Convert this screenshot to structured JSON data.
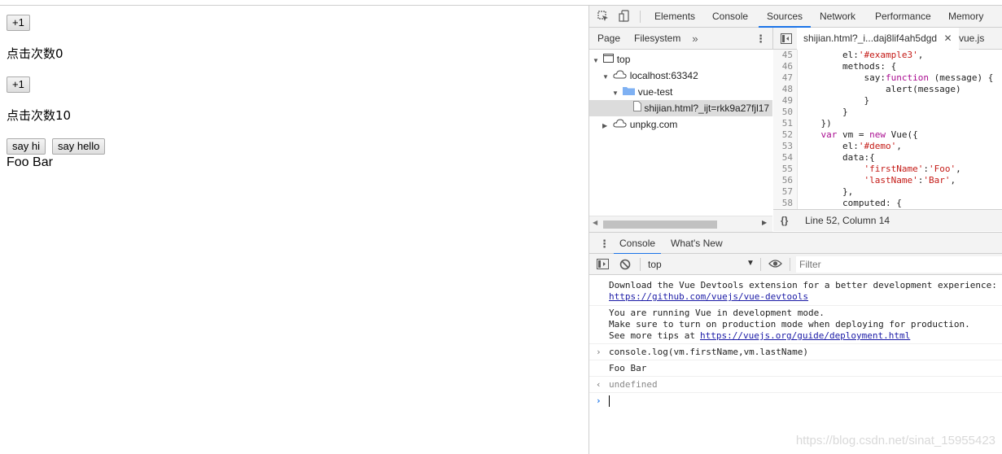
{
  "page": {
    "btn_plus_1": "+1",
    "count_text_1": "点击次数0",
    "btn_plus_2": "+1",
    "count_text_2": "点击次数10",
    "btn_say_hi": "say hi",
    "btn_say_hello": "say hello",
    "full_name": "Foo Bar"
  },
  "devtools": {
    "main_tabs": [
      "Elements",
      "Console",
      "Sources",
      "Network",
      "Performance",
      "Memory"
    ],
    "active_main_tab": "Sources",
    "nav_tabs": [
      "Page",
      "Filesystem"
    ],
    "file_tabs": [
      "shijian.html?_i...daj8lif4ah5dgd",
      "vue.js"
    ],
    "tree": [
      {
        "label": "top",
        "icon": "frame-icon"
      },
      {
        "label": "localhost:63342",
        "icon": "cloud-icon"
      },
      {
        "label": "vue-test",
        "icon": "folder-icon"
      },
      {
        "label": "shijian.html?_ijt=rkk9a27fjl17",
        "icon": "file-icon"
      },
      {
        "label": "unpkg.com",
        "icon": "cloud-icon"
      }
    ],
    "code_lines": [
      {
        "n": "45",
        "t": "        el:'#example3',"
      },
      {
        "n": "46",
        "t": "        methods: {"
      },
      {
        "n": "47",
        "t": "            say:function (message) {"
      },
      {
        "n": "48",
        "t": "                alert(message)"
      },
      {
        "n": "49",
        "t": "            }"
      },
      {
        "n": "50",
        "t": "        }"
      },
      {
        "n": "51",
        "t": "    })"
      },
      {
        "n": "52",
        "t": "    var vm = new Vue({"
      },
      {
        "n": "53",
        "t": "        el:'#demo',"
      },
      {
        "n": "54",
        "t": "        data:{"
      },
      {
        "n": "55",
        "t": "            'firstName':'Foo',"
      },
      {
        "n": "56",
        "t": "            'lastName':'Bar',"
      },
      {
        "n": "57",
        "t": "        },"
      },
      {
        "n": "58",
        "t": "        computed: {"
      }
    ],
    "status": {
      "braces": "{}",
      "position": "Line 52, Column 14"
    },
    "drawer_tabs": [
      "Console",
      "What's New"
    ],
    "console_toolbar": {
      "context": "top",
      "filter_placeholder": "Filter"
    },
    "messages": {
      "m1_line1": "Download the Vue Devtools extension for a better development experience:",
      "m1_link": "https://github.com/vuejs/vue-devtools",
      "m2_line1": "You are running Vue in development mode.",
      "m2_line2": "Make sure to turn on production mode when deploying for production.",
      "m2_line3_prefix": "See more tips at ",
      "m2_link": "https://vuejs.org/guide/deployment.html",
      "m3_input": "console.log(vm.firstName,vm.lastName)",
      "m4_output": "Foo Bar",
      "m5_result": "undefined"
    }
  },
  "watermark": "https://blog.csdn.net/sinat_15955423",
  "colors": {
    "accent": "#1a73e8",
    "link": "#1a1aa6",
    "keyword": "#aa0d91",
    "string": "#c41a16"
  }
}
